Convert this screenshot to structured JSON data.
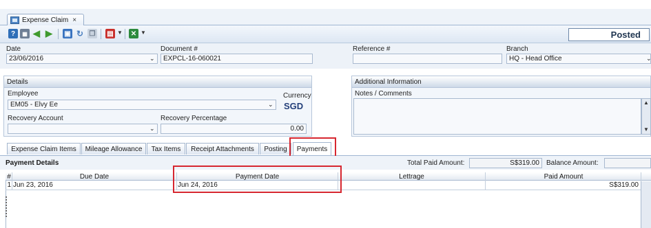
{
  "window": {
    "tab_title": "Expense Claim",
    "tab_close": "×"
  },
  "toolbar": {
    "icons": [
      "help-icon",
      "grid-view-icon",
      "back-arrow-icon",
      "forward-arrow-icon",
      "save-icon",
      "refresh-icon",
      "copy-icon",
      "pdf-report-icon",
      "excel-export-icon"
    ],
    "status": "Posted"
  },
  "header": {
    "date_label": "Date",
    "date_value": "23/06/2016",
    "document_label": "Document #",
    "document_value": "EXPCL-16-060021",
    "reference_label": "Reference #",
    "reference_value": "",
    "branch_label": "Branch",
    "branch_value": "HQ - Head Office"
  },
  "details": {
    "title": "Details",
    "employee_label": "Employee",
    "employee_value": "EM05 - Elvy Ee",
    "currency_label": "Currency",
    "currency_value": "SGD",
    "recovery_account_label": "Recovery Account",
    "recovery_account_value": "",
    "recovery_percentage_label": "Recovery Percentage",
    "recovery_percentage_value": "0.00"
  },
  "additional": {
    "title": "Additional Information",
    "notes_label": "Notes / Comments",
    "notes_value": ""
  },
  "tabs": [
    {
      "label": "Expense Claim Items"
    },
    {
      "label": "Mileage Allowance"
    },
    {
      "label": "Tax Items"
    },
    {
      "label": "Receipt Attachments"
    },
    {
      "label": "Posting"
    },
    {
      "label": "Payments"
    }
  ],
  "payments": {
    "title": "Payment Details",
    "total_paid_label": "Total Paid Amount:",
    "total_paid_value": "S$319.00",
    "balance_label": "Balance Amount:",
    "balance_value": "",
    "columns": [
      "#",
      "Due Date",
      "Payment Date",
      "Lettrage",
      "Paid Amount"
    ],
    "rows": [
      {
        "num": "1",
        "due_date": "Jun 23, 2016",
        "payment_date": "Jun 24, 2016",
        "lettrage": "",
        "paid_amount": "S$319.00"
      }
    ]
  },
  "colors": {
    "highlight": "#d6262f",
    "currency_text": "#24407a",
    "panel_bg": "#f2f6fb"
  }
}
